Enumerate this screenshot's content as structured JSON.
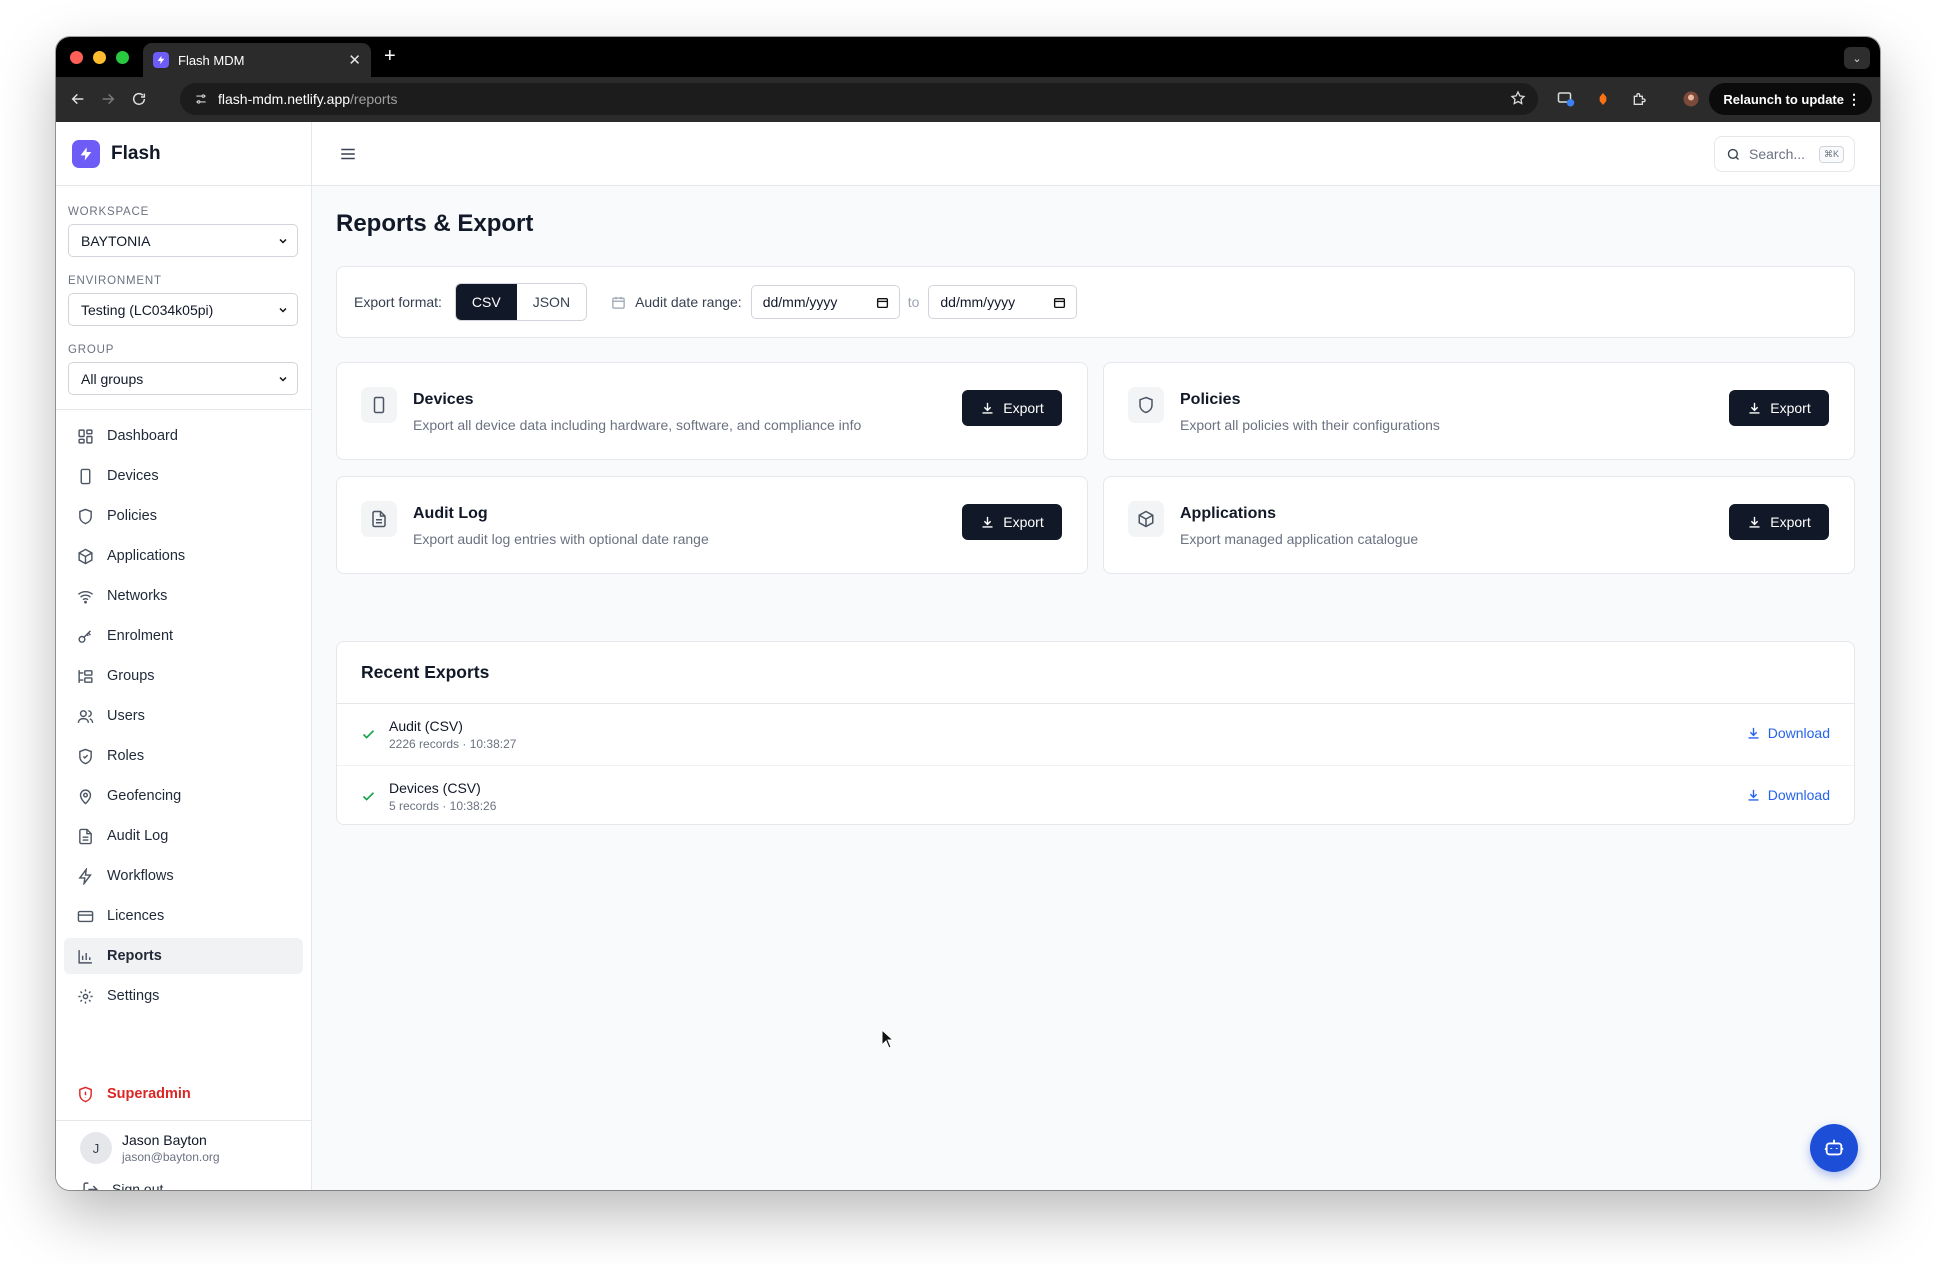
{
  "browser": {
    "tab_title": "Flash MDM",
    "url_host": "flash-mdm.netlify.app",
    "url_path": "/reports",
    "relaunch_label": "Relaunch to update"
  },
  "sidebar": {
    "brand": "Flash",
    "workspace_label": "WORKSPACE",
    "workspace_value": "BAYTONIA",
    "environment_label": "ENVIRONMENT",
    "environment_value": "Testing (LC034k05pi)",
    "group_label": "GROUP",
    "group_value": "All groups",
    "items": [
      {
        "label": "Dashboard",
        "icon": "grid-icon"
      },
      {
        "label": "Devices",
        "icon": "phone-icon"
      },
      {
        "label": "Policies",
        "icon": "shield-icon"
      },
      {
        "label": "Applications",
        "icon": "box-icon"
      },
      {
        "label": "Networks",
        "icon": "wifi-icon"
      },
      {
        "label": "Enrolment",
        "icon": "key-icon"
      },
      {
        "label": "Groups",
        "icon": "groups-icon"
      },
      {
        "label": "Users",
        "icon": "users-icon"
      },
      {
        "label": "Roles",
        "icon": "shield-check-icon"
      },
      {
        "label": "Geofencing",
        "icon": "map-pin-icon"
      },
      {
        "label": "Audit Log",
        "icon": "file-icon"
      },
      {
        "label": "Workflows",
        "icon": "bolt-icon"
      },
      {
        "label": "Licences",
        "icon": "card-icon"
      },
      {
        "label": "Reports",
        "icon": "bar-chart-icon"
      },
      {
        "label": "Settings",
        "icon": "gear-icon"
      }
    ],
    "active_item": "Reports",
    "superadmin_label": "Superadmin",
    "user": {
      "initial": "J",
      "name": "Jason Bayton",
      "email": "jason@bayton.org"
    },
    "signout_label": "Sign out"
  },
  "topbar": {
    "search_placeholder": "Search...",
    "search_shortcut": "⌘K"
  },
  "main": {
    "title": "Reports & Export",
    "filters": {
      "export_format_label": "Export format:",
      "formats": [
        "CSV",
        "JSON"
      ],
      "selected_format": "CSV",
      "date_range_label": "Audit date range:",
      "date_from": "dd/mm/yyyy",
      "to_label": "to",
      "date_to": "dd/mm/yyyy"
    },
    "cards": [
      {
        "title": "Devices",
        "desc": "Export all device data including hardware, software, and compliance info",
        "button": "Export",
        "icon": "phone-icon"
      },
      {
        "title": "Policies",
        "desc": "Export all policies with their configurations",
        "button": "Export",
        "icon": "shield-icon"
      },
      {
        "title": "Audit Log",
        "desc": "Export audit log entries with optional date range",
        "button": "Export",
        "icon": "file-icon"
      },
      {
        "title": "Applications",
        "desc": "Export managed application catalogue",
        "button": "Export",
        "icon": "box-icon"
      }
    ],
    "recent": {
      "title": "Recent Exports",
      "rows": [
        {
          "name": "Audit (CSV)",
          "meta": "2226 records · 10:38:27",
          "action": "Download"
        },
        {
          "name": "Devices (CSV)",
          "meta": "5 records · 10:38:26",
          "action": "Download"
        }
      ]
    }
  },
  "colors": {
    "brand": "#6d5cf6",
    "primary_button": "#111827",
    "link": "#2563eb",
    "success": "#16a34a",
    "danger": "#dc2626",
    "fab": "#1d4ed8"
  }
}
